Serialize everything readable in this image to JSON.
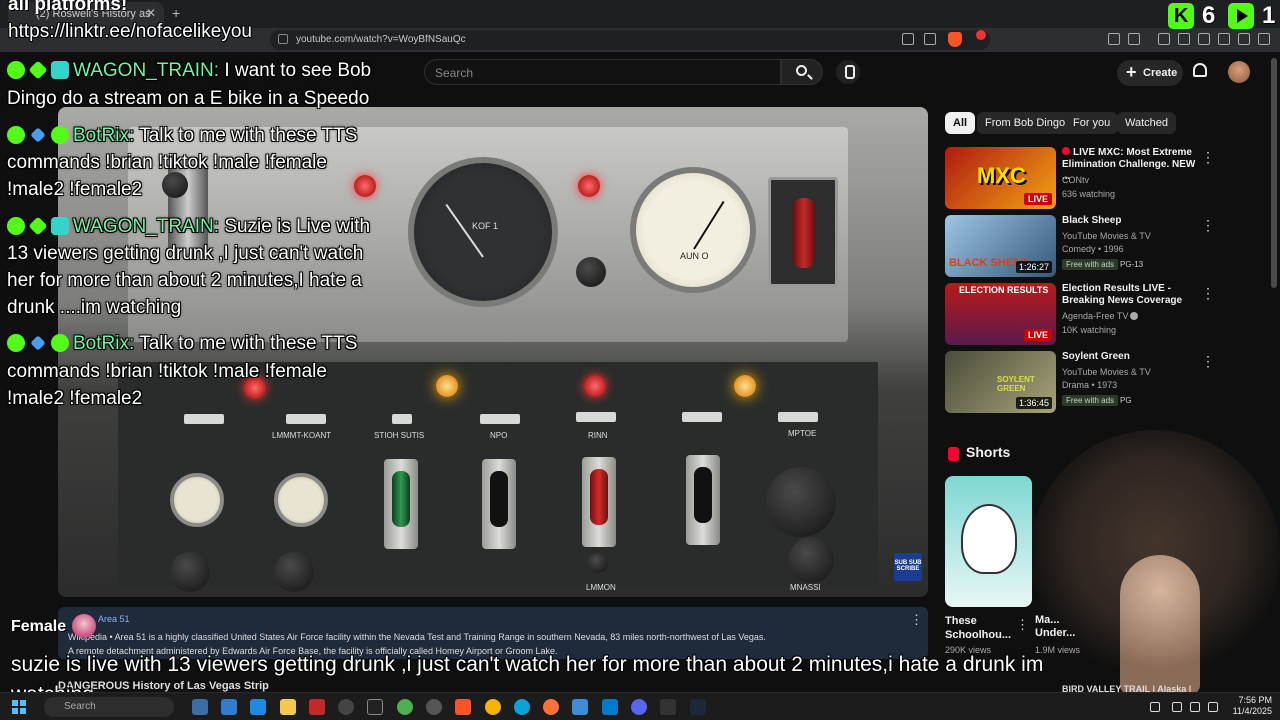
{
  "browser": {
    "tab_title": "(2) Roswell's History as",
    "url": "youtube.com/watch?v=WoyBfNSauQc"
  },
  "overlay": {
    "top_text": "all platforms!",
    "link": "https://linktr.ee/nofacelikeyou",
    "kick_viewers": "6",
    "other_viewers": "1",
    "female_label": "Female",
    "caption_line1": "suzie is live with 13 viewers getting drunk ,i just can't watch her for more than about 2 minutes,i hate a drunk im",
    "caption_line2": "watching"
  },
  "chat": [
    {
      "user": "WAGON_TRAIN:",
      "lines": [
        "I want to see Bob",
        "Dingo do a stream on a E bike in a Speedo"
      ]
    },
    {
      "user": "BotRix:",
      "lines": [
        "Talk to me with these TTS",
        "commands !brian !tiktok !male !female",
        "!male2 !female2"
      ]
    },
    {
      "user": "WAGON_TRAIN:",
      "lines": [
        "Suzie is Live with",
        "13 viewers getting drunk ,I just can't watch",
        "her for more than about 2 minutes,I hate a",
        "drunk ....im watching"
      ]
    },
    {
      "user": "BotRix:",
      "lines": [
        "Talk to me with these TTS",
        "commands !brian !tiktok !male !female",
        "!male2 !female2"
      ]
    }
  ],
  "header": {
    "search_placeholder": "Search",
    "create_label": "Create"
  },
  "filters": [
    "All",
    "From Bob Dingo",
    "For you",
    "Watched"
  ],
  "related": [
    {
      "title": "LIVE MXC: Most Extreme Elimination Challenge. NEW ...",
      "channel": "CONtv",
      "meta": "636 watching",
      "badge": "LIVE",
      "thumb_text": "MXC"
    },
    {
      "title": "Black Sheep",
      "channel": "YouTube Movies & TV",
      "meta": "Comedy • 1996",
      "badge_free": "Free with ads",
      "rating": "PG-13",
      "duration": "1:26:27",
      "thumb_text": "BLACK SHEEP"
    },
    {
      "title": "Election Results LIVE - Breaking News Coverage",
      "channel": "Agenda-Free TV",
      "meta": "10K watching",
      "badge": "LIVE",
      "thumb_text": "ELECTION RESULTS"
    },
    {
      "title": "Soylent Green",
      "channel": "YouTube Movies & TV",
      "meta": "Drama • 1973",
      "badge_free": "Free with ads",
      "rating": "PG",
      "duration": "1:36:45",
      "thumb_text": "SOYLENT GREEN"
    }
  ],
  "shorts": {
    "heading": "Shorts",
    "items": [
      {
        "title": "These Schoolhou...",
        "views": "290K views"
      },
      {
        "title": "Ma...",
        "subtitle": "Under...",
        "views": "1.9M views"
      }
    ]
  },
  "info_panel": {
    "title": "Area 51",
    "source": "Wikipedia",
    "line1": "Area 51 is a highly classified United States Air Force facility within the Nevada Test and Training Range in southern Nevada, 83 miles north-northwest of Las Vegas.",
    "line2": "A remote detachment administered by Edwards Air Force Base, the facility is officially called Homey Airport or Groom Lake."
  },
  "below": {
    "next_title": "DANGEROUS History of Las Vegas Strip",
    "next_related": "BIRD VALLEY TRAIL | Alaska |"
  },
  "video_labels": {
    "gauge1_text": "KOF 1",
    "gauge2_text": "AUN O",
    "labels": [
      "LMMMT-KOANT",
      "STIOH SUTIS",
      "NPO",
      "RINN",
      "MPTOE",
      "LMMON",
      "MNASSI"
    ],
    "subscribe": "SUB SUB SCRIBE"
  },
  "taskbar": {
    "search": "Search",
    "time": "7:56 PM",
    "date": "11/4/2025"
  },
  "colors": {
    "kick_green": "#53fc18",
    "yt_red": "#ff0033",
    "chat_name": "#6ff5a3"
  }
}
